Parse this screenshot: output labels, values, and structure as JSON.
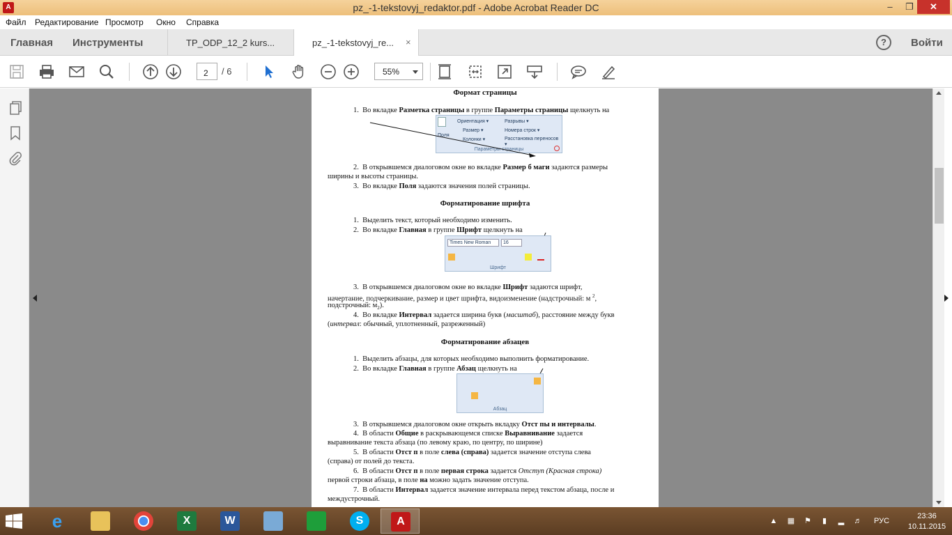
{
  "window": {
    "title": "pz_-1-tekstovyj_redaktor.pdf - Adobe Acrobat Reader DC",
    "app_icon_label": "A"
  },
  "menu": [
    "Файл",
    "Редактирование",
    "Просмотр",
    "Окно",
    "Справка"
  ],
  "tabs": {
    "home": "Главная",
    "tools": "Инструменты",
    "doc1": "TP_ODP_12_2 kurs...",
    "doc2": "pz_-1-tekstovyj_re...",
    "close_glyph": "×",
    "login": "Войти"
  },
  "toolbar": {
    "page_current": "2",
    "page_total": "/  6",
    "zoom": "55%"
  },
  "document": {
    "h1": "Формат страницы",
    "h2": "Форматирование шрифта",
    "h3": "Форматирование абзацев",
    "ribbon1": {
      "cap": "Параметры страницы",
      "i1": "Ориентация ▾",
      "i2": "Разрывы ▾",
      "i3": "Размер ▾",
      "i4": "Номера строк ▾",
      "i5": "Колонки ▾",
      "i6": "Расстановка переносов ▾",
      "i7": "Поля"
    },
    "ribbon2": {
      "cap": "Шрифт",
      "font": "Times New Roman",
      "size": "16"
    },
    "ribbon3": {
      "cap": "Абзац"
    }
  },
  "taskbar": {
    "lang": "РУС",
    "time": "23:36",
    "date": "10.11.2015"
  }
}
